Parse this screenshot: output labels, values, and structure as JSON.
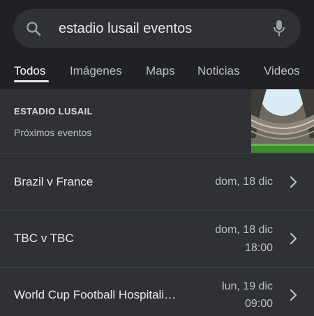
{
  "search": {
    "query": "estadio lusail eventos"
  },
  "tabs": [
    {
      "label": "Todos",
      "active": true
    },
    {
      "label": "Imágenes"
    },
    {
      "label": "Maps"
    },
    {
      "label": "Noticias"
    },
    {
      "label": "Videos"
    }
  ],
  "entity": {
    "title": "ESTADIO LUSAIL",
    "subtitle": "Próximos eventos"
  },
  "events": [
    {
      "name": "Brazil v France",
      "date": "dom, 18 dic",
      "time": ""
    },
    {
      "name": "TBC v TBC",
      "date": "dom, 18 dic",
      "time": "18:00"
    },
    {
      "name": "World Cup Football Hospitali…",
      "date": "lun, 19 dic",
      "time": "09:00"
    }
  ],
  "icons": {
    "search": "search-icon",
    "mic": "microphone-icon",
    "chevron": "chevron-right-icon"
  },
  "colors": {
    "background": "#202124",
    "surface": "#303134",
    "text": "#e8eaed",
    "secondary_text": "#bdc1c6"
  }
}
